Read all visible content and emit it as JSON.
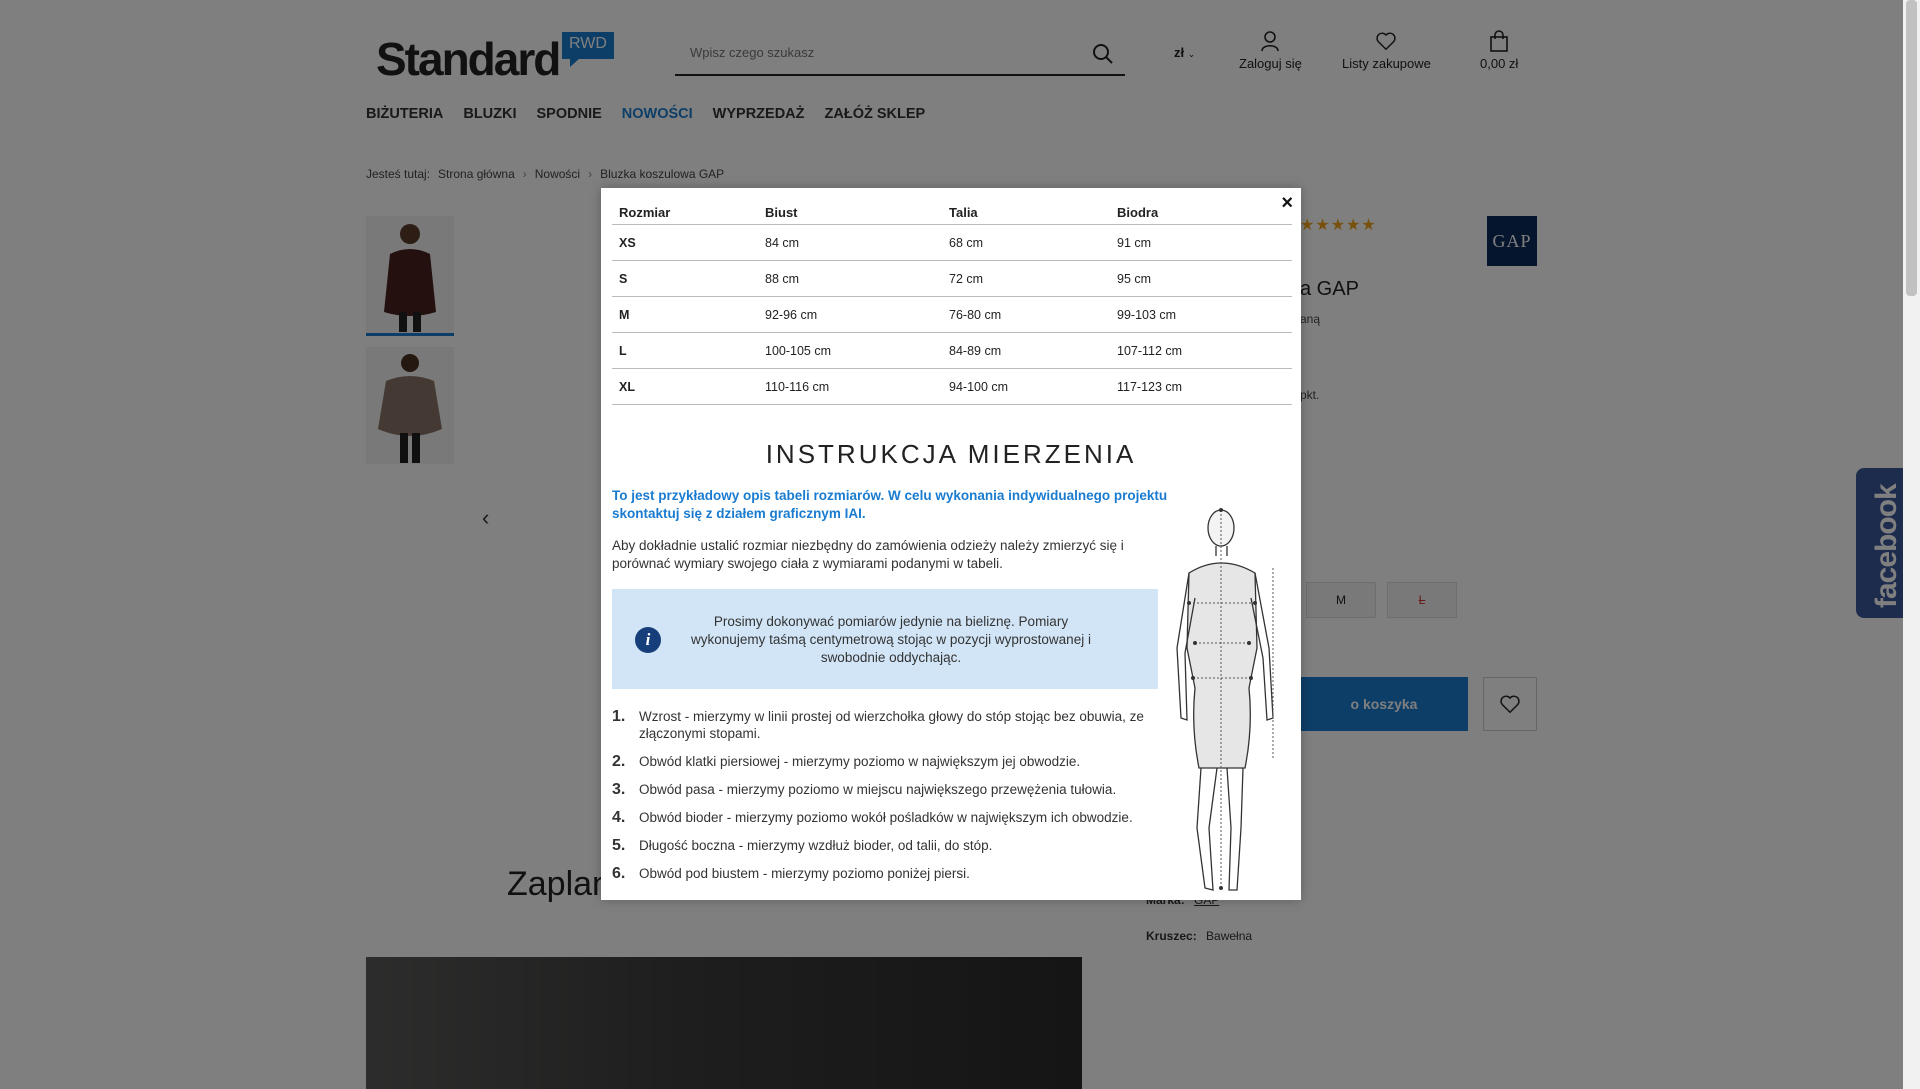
{
  "header": {
    "logo": "Standard",
    "logo_badge": "RWD",
    "search_placeholder": "Wpisz czego szukasz",
    "currency": "zł",
    "login_label": "Zaloguj się",
    "lists_label": "Listy zakupowe",
    "cart_total": "0,00 zł"
  },
  "nav": [
    "BIŻUTERIA",
    "BLUZKI",
    "SPODNIE",
    "NOWOŚCI",
    "WYPRZEDAŻ",
    "ZAŁÓŻ SKLEP"
  ],
  "nav_active": "NOWOŚCI",
  "breadcrumb": {
    "prefix": "Jesteś tutaj:",
    "items": [
      "Strona główna",
      "Nowości",
      "Bluzka koszulowa GAP"
    ]
  },
  "product": {
    "brand_logo": "GAP",
    "title_fragment": "a GAP",
    "sub_fragment": "aną",
    "points_fragment": "pkt.",
    "visible_sizes": [
      "M",
      "L"
    ],
    "add_to_cart_fragment": "o koszyka",
    "brand_label": "Marka:",
    "brand_value": "GAP",
    "material_label": "Kruszec:",
    "material_value": "Bawełna",
    "rating_stars": 5
  },
  "section_title_fragment": "Zaplan",
  "facebook_tab": "facebook",
  "modal": {
    "close_glyph": "×",
    "size_table": {
      "headers": [
        "Rozmiar",
        "Biust",
        "Talia",
        "Biodra"
      ],
      "rows": [
        [
          "XS",
          "84 cm",
          "68 cm",
          "91 cm"
        ],
        [
          "S",
          "88 cm",
          "72 cm",
          "95 cm"
        ],
        [
          "M",
          "92-96 cm",
          "76-80 cm",
          "99-103 cm"
        ],
        [
          "L",
          "100-105 cm",
          "84-89 cm",
          "107-112 cm"
        ],
        [
          "XL",
          "110-116 cm",
          "94-100 cm",
          "117-123 cm"
        ]
      ]
    },
    "instructions_title": "INSTRUKCJA MIERZENIA",
    "blue_note": "To jest przykładowy opis tabeli rozmiarów. W celu wykonania indywidualnego projektu skontaktuj się z działem graficznym IAI.",
    "description": "Aby dokładnie ustalić rozmiar niezbędny do zamówienia odzieży należy zmierzyć się i porównać wymiary swojego ciała z wymiarami podanymi w tabeli.",
    "info_box": "Prosimy dokonywać pomiarów jedynie na bieliznę. Pomiary wykonujemy taśmą centymetrową stojąc w pozycji wyprostowanej i swobodnie oddychając.",
    "steps": [
      "Wzrost - mierzymy w linii prostej od wierzchołka głowy do stóp stojąc bez obuwia, ze złączonymi stopami.",
      "Obwód klatki piersiowej - mierzymy poziomo w największym jej obwodzie.",
      "Obwód pasa - mierzymy poziomo w miejscu największego przewężenia tułowia.",
      "Obwód bioder - mierzymy poziomo wokół pośladków w największym ich obwodzie.",
      "Długość boczna - mierzymy wzdłuż bioder, od talii, do stóp.",
      "Obwód pod biustem - mierzymy poziomo poniżej piersi."
    ]
  }
}
